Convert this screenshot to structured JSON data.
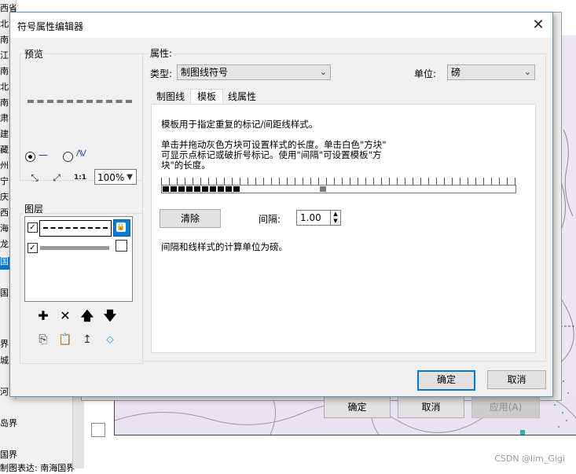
{
  "background": {
    "side_items": [
      "西省",
      "北",
      "南",
      "江",
      "南",
      "北",
      "南",
      "肃",
      "建",
      "藏",
      "州",
      "宁",
      "庆",
      "西",
      "海",
      "龙",
      "国",
      "国"
    ],
    "bottom_items": [
      "岛界",
      "国界",
      "制图表达: 南海国界"
    ],
    "left_partial": [
      "界",
      "城",
      "河"
    ],
    "dialog_buttons": {
      "ok": "确定",
      "cancel": "取消",
      "apply": "应用(A)"
    },
    "watermark": "CSDN @lim_Gigi"
  },
  "dialog": {
    "title": "符号属性编辑器",
    "close_glyph": "✕",
    "preview": {
      "label": "预览",
      "radio_line_glyph": "—",
      "radio_zigzag_glyph": "⋀⋁",
      "zoom_in_glyph": "⤡",
      "zoom_out_glyph": "⤢",
      "actual_size_glyph": "1:1",
      "zoom_value": "100%"
    },
    "layers": {
      "label": "图层",
      "add_glyph": "✚",
      "remove_glyph": "✕",
      "up_glyph": "🡅",
      "down_glyph": "🡇"
    },
    "properties": {
      "label": "属性:",
      "type_label": "类型:",
      "type_value": "制图线符号",
      "unit_label": "单位:",
      "unit_value": "磅",
      "tabs": [
        "制图线",
        "模板",
        "线属性"
      ],
      "active_tab": "模板",
      "template": {
        "intro": "模板用于指定重复的标记/间距线样式。",
        "instruction_line1": "单击并拖动灰色方块可设置样式的长度。单击白色\"方块\"",
        "instruction_line2": "可显示点标记或破折号标记。使用\"间隔\"可设置模板\"方",
        "instruction_line3": "块\"的长度。",
        "filled_cells": 10,
        "handle_cell": 20,
        "total_cells": 45,
        "clear_label": "清除",
        "interval_label": "间隔:",
        "interval_value": "1.00",
        "footer_note": "间隔和线样式的计算单位为磅。"
      }
    },
    "buttons": {
      "ok": "确定",
      "cancel": "取消"
    }
  }
}
